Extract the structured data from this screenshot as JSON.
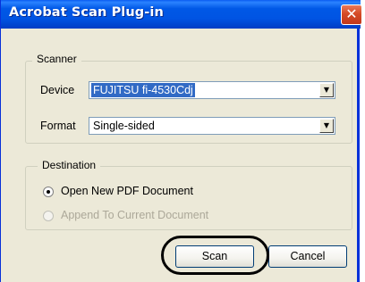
{
  "window": {
    "title": "Acrobat Scan Plug-in",
    "close_glyph": "✕"
  },
  "scanner": {
    "legend": "Scanner",
    "device_label": "Device",
    "device_value": "FUJITSU fi-4530Cdj",
    "format_label": "Format",
    "format_value": "Single-sided"
  },
  "destination": {
    "legend": "Destination",
    "options": [
      {
        "label": "Open New PDF Document",
        "selected": true,
        "enabled": true
      },
      {
        "label": "Append To Current Document",
        "selected": false,
        "enabled": false
      }
    ]
  },
  "buttons": {
    "scan": "Scan",
    "cancel": "Cancel"
  },
  "colors": {
    "titlebar": "#0054e3",
    "selection": "#316ac5",
    "dialog_bg": "#ece9d8",
    "disabled_text": "#aca899"
  },
  "icons": {
    "combo_arrow": "chevron-down-icon",
    "close": "close-icon"
  }
}
